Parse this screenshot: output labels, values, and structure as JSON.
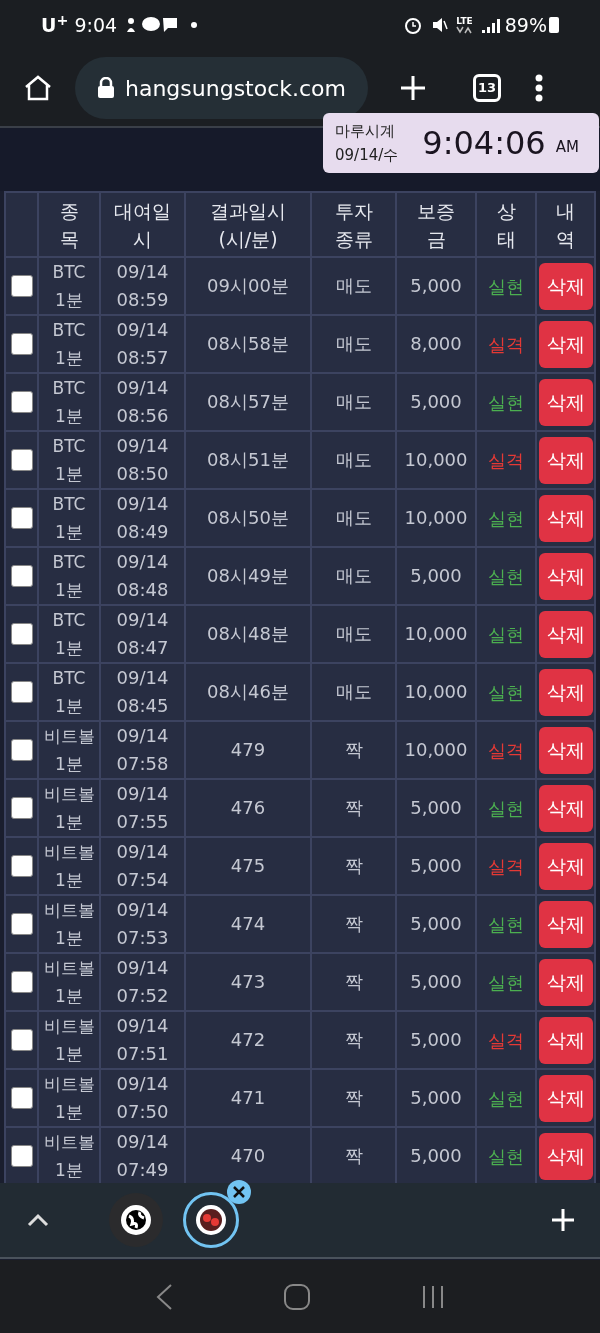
{
  "status_bar": {
    "carrier": "U$^{+}$",
    "time": "9:04",
    "battery": "89%",
    "network": "LTE"
  },
  "browser": {
    "url": "hangsungstock.com",
    "tab_count": "13"
  },
  "clock_overlay": {
    "title": "마루시계",
    "date": "09/14/수",
    "time": "9:04:06",
    "period": "AM"
  },
  "table": {
    "columns": [
      "종\n목",
      "대여일\n시",
      "결과일시\n(시/분)",
      "투자\n종류",
      "보증\n금",
      "상\n태",
      "내\n역"
    ],
    "rows": [
      {
        "checked": false,
        "item": "BTC\n1분",
        "date": "09/14\n08:59",
        "result": "09시00분",
        "type": "매도",
        "deposit": "5,000",
        "status": "실현",
        "color": "#4caf50",
        "action": "삭제"
      },
      {
        "checked": false,
        "item": "BTC\n1분",
        "date": "09/14\n08:57",
        "result": "08시58분",
        "type": "매도",
        "deposit": "8,000",
        "status": "실격",
        "color": "#e53935",
        "action": "삭제"
      },
      {
        "checked": false,
        "item": "BTC\n1분",
        "date": "09/14\n08:56",
        "result": "08시57분",
        "type": "매도",
        "deposit": "5,000",
        "status": "실현",
        "color": "#4caf50",
        "action": "삭제"
      },
      {
        "checked": false,
        "item": "BTC\n1분",
        "date": "09/14\n08:50",
        "result": "08시51분",
        "type": "매도",
        "deposit": "10,000",
        "status": "실격",
        "color": "#e53935",
        "action": "삭제"
      },
      {
        "checked": false,
        "item": "BTC\n1분",
        "date": "09/14\n08:49",
        "result": "08시50분",
        "type": "매도",
        "deposit": "10,000",
        "status": "실현",
        "color": "#4caf50",
        "action": "삭제"
      },
      {
        "checked": false,
        "item": "BTC\n1분",
        "date": "09/14\n08:48",
        "result": "08시49분",
        "type": "매도",
        "deposit": "5,000",
        "status": "실현",
        "color": "#4caf50",
        "action": "삭제"
      },
      {
        "checked": false,
        "item": "BTC\n1분",
        "date": "09/14\n08:47",
        "result": "08시48분",
        "type": "매도",
        "deposit": "10,000",
        "status": "실현",
        "color": "#4caf50",
        "action": "삭제"
      },
      {
        "checked": false,
        "item": "BTC\n1분",
        "date": "09/14\n08:45",
        "result": "08시46분",
        "type": "매도",
        "deposit": "10,000",
        "status": "실현",
        "color": "#4caf50",
        "action": "삭제"
      },
      {
        "checked": false,
        "item": "비트볼\n1분",
        "date": "09/14\n07:58",
        "result": "479",
        "type": "짝",
        "deposit": "10,000",
        "status": "실격",
        "color": "#e53935",
        "action": "삭제"
      },
      {
        "checked": false,
        "item": "비트볼\n1분",
        "date": "09/14\n07:55",
        "result": "476",
        "type": "짝",
        "deposit": "5,000",
        "status": "실현",
        "color": "#4caf50",
        "action": "삭제"
      },
      {
        "checked": false,
        "item": "비트볼\n1분",
        "date": "09/14\n07:54",
        "result": "475",
        "type": "짝",
        "deposit": "5,000",
        "status": "실격",
        "color": "#e53935",
        "action": "삭제"
      },
      {
        "checked": false,
        "item": "비트볼\n1분",
        "date": "09/14\n07:53",
        "result": "474",
        "type": "짝",
        "deposit": "5,000",
        "status": "실현",
        "color": "#4caf50",
        "action": "삭제"
      },
      {
        "checked": false,
        "item": "비트볼\n1분",
        "date": "09/14\n07:52",
        "result": "473",
        "type": "짝",
        "deposit": "5,000",
        "status": "실현",
        "color": "#4caf50",
        "action": "삭제"
      },
      {
        "checked": false,
        "item": "비트볼\n1분",
        "date": "09/14\n07:51",
        "result": "472",
        "type": "짝",
        "deposit": "5,000",
        "status": "실격",
        "color": "#e53935",
        "action": "삭제"
      },
      {
        "checked": false,
        "item": "비트볼\n1분",
        "date": "09/14\n07:50",
        "result": "471",
        "type": "짝",
        "deposit": "5,000",
        "status": "실현",
        "color": "#4caf50",
        "action": "삭제"
      },
      {
        "checked": false,
        "item": "비트볼\n1분",
        "date": "09/14\n07:49",
        "result": "470",
        "type": "짝",
        "deposit": "5,000",
        "status": "실현",
        "color": "#4caf50",
        "action": "삭제"
      }
    ]
  }
}
